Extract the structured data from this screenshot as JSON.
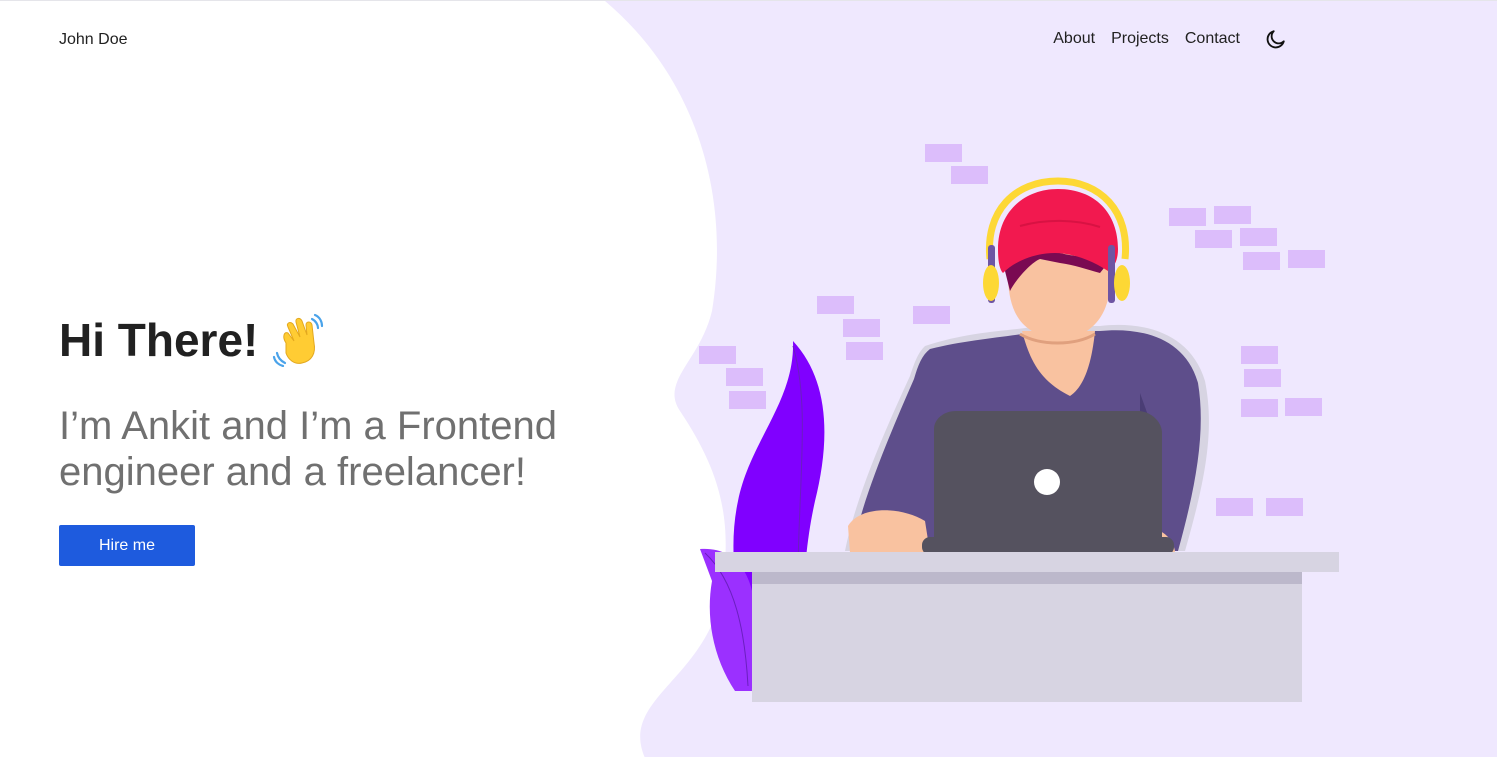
{
  "nav": {
    "brand": "John Doe",
    "links": [
      {
        "label": "About"
      },
      {
        "label": "Projects"
      },
      {
        "label": "Contact"
      }
    ],
    "theme_toggle_icon": "moon-icon"
  },
  "hero": {
    "greeting": "Hi There!",
    "greeting_icon": "waving-hand-icon",
    "intro": "I’m Ankit and I’m a Frontend engineer and a freelancer!",
    "cta_label": "Hire me"
  },
  "illustration": {
    "name": "developer-at-laptop-illustration"
  },
  "colors": {
    "accent": "#1e5bde",
    "background_blob": "#efe8fe",
    "text_primary": "#212121",
    "text_secondary": "#707070",
    "brick": "#dcbdfb",
    "shirt": "#5e4e8b",
    "cap": "#f2194f",
    "headphones": "#fdd835",
    "laptop": "#55525f",
    "desk": "#d7d4e2",
    "plant": "#8000ff"
  }
}
